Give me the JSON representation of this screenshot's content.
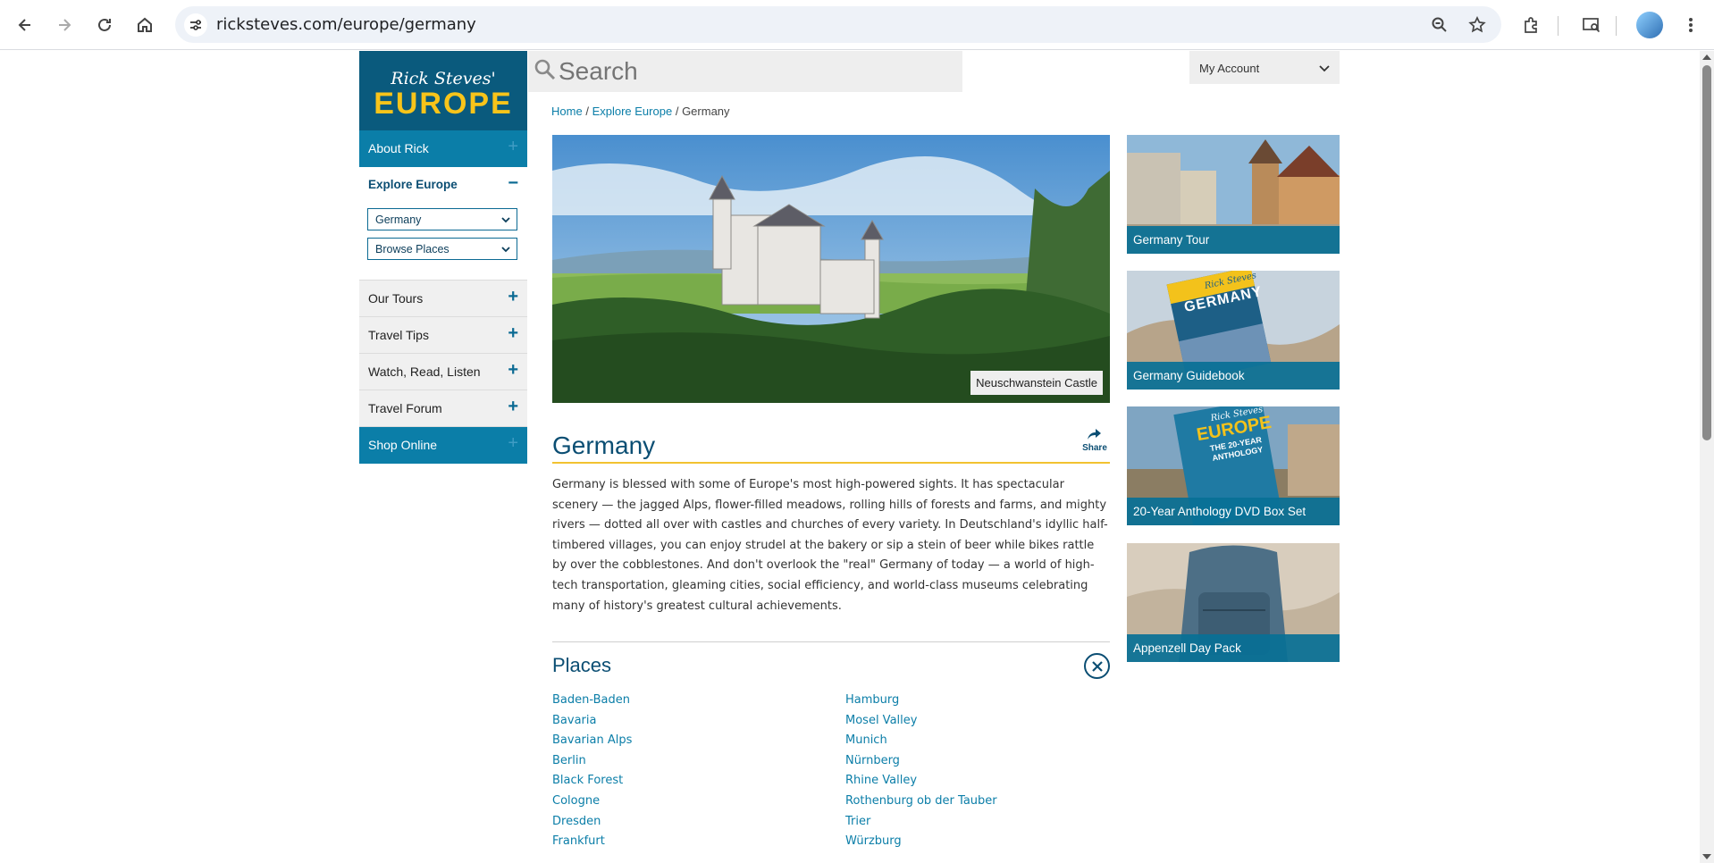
{
  "browser": {
    "url": "ricksteves.com/europe/germany"
  },
  "site": {
    "logo_script": "Rick Steves'",
    "logo_main": "EUROPE"
  },
  "search": {
    "placeholder": "Search"
  },
  "account": {
    "label": "My Account"
  },
  "left_nav": {
    "about": "About Rick",
    "explore": "Explore Europe",
    "explore_toggle": "−",
    "country_select": "Germany",
    "places_select": "Browse Places",
    "items": [
      {
        "label": "Our Tours",
        "toggle": "+"
      },
      {
        "label": "Travel Tips",
        "toggle": "+"
      },
      {
        "label": "Watch, Read, Listen",
        "toggle": "+"
      },
      {
        "label": "Travel Forum",
        "toggle": "+"
      }
    ],
    "shop": "Shop Online",
    "plus": "+"
  },
  "breadcrumb": {
    "home": "Home",
    "sep": "/",
    "explore": "Explore Europe",
    "current": "Germany"
  },
  "hero": {
    "caption": "Neuschwanstein Castle"
  },
  "article": {
    "title": "Germany",
    "share": "Share",
    "body": "Germany is blessed with some of Europe's most high-powered sights. It has spectacular scenery — the jagged Alps, flower-filled meadows, rolling hills of forests and farms, and mighty rivers — dotted all over with castles and churches of every variety. In Deutschland's idyllic half-timbered villages, you can enjoy strudel at the bakery or sip a stein of beer while bikes rattle by over the cobblestones. And don't overlook the \"real\" Germany of today — a world of high-tech transportation, gleaming cities, social efficiency, and world-class museums celebrating many of history's greatest cultural achievements."
  },
  "places": {
    "title": "Places",
    "col1": [
      "Baden-Baden",
      "Bavaria",
      "Bavarian Alps",
      "Berlin",
      "Black Forest",
      "Cologne",
      "Dresden",
      "Frankfurt"
    ],
    "col2": [
      "Hamburg",
      "Mosel Valley",
      "Munich",
      "Nürnberg",
      "Rhine Valley",
      "Rothenburg ob der Tauber",
      "Trier",
      "Würzburg"
    ]
  },
  "promos": [
    {
      "label": "Germany Tour"
    },
    {
      "label": "Germany Guidebook",
      "book_brand": "Rick Steves",
      "book_title": "GERMANY"
    },
    {
      "label": "20-Year Anthology DVD Box Set",
      "book_brand": "Rick Steves",
      "book_title": "EUROPE",
      "book_sub": "THE 20-YEAR ANTHOLOGY"
    },
    {
      "label": "Appenzell Day Pack"
    }
  ],
  "colors": {
    "brand_dark": "#0a5a7d",
    "brand_blue": "#0b7ea8",
    "accent_yellow": "#f2c230"
  }
}
